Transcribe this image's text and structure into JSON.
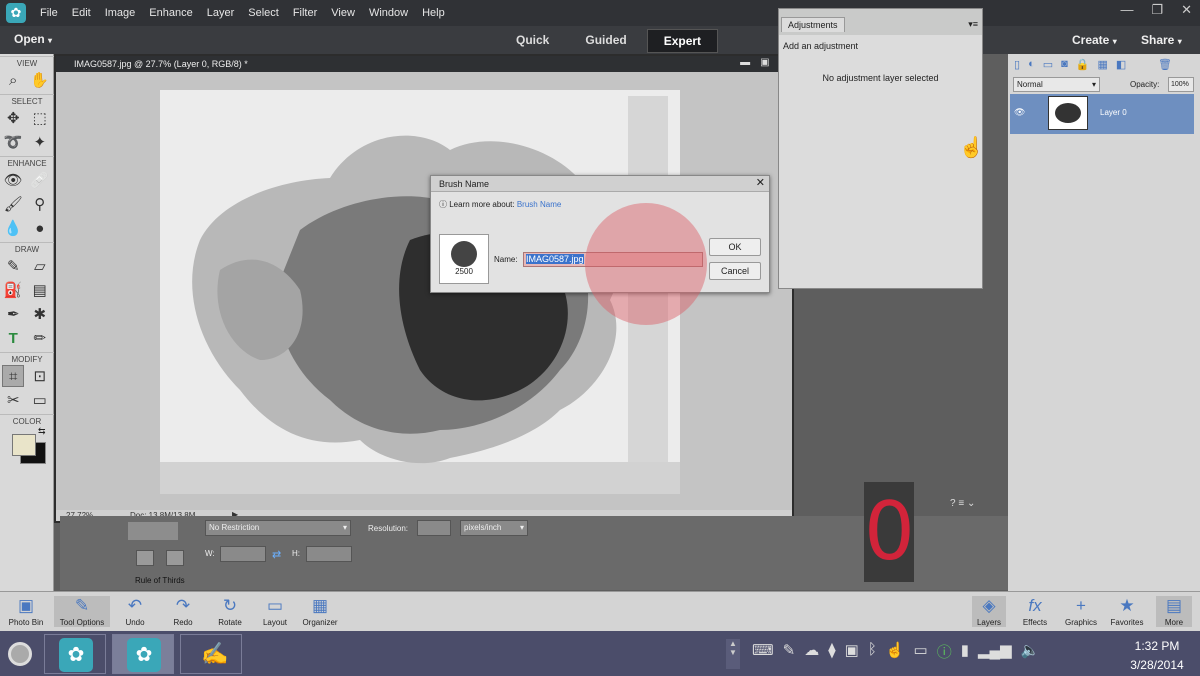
{
  "menubar": {
    "items": [
      "File",
      "Edit",
      "Image",
      "Enhance",
      "Layer",
      "Select",
      "Filter",
      "View",
      "Window",
      "Help"
    ],
    "window_controls": [
      "—",
      "❐",
      "✕"
    ]
  },
  "modebar": {
    "open": "Open",
    "tabs": [
      "Quick",
      "Guided",
      "Expert"
    ],
    "active_tab": "Expert",
    "create": "Create",
    "share": "Share"
  },
  "toolbox": {
    "sections": [
      "VIEW",
      "SELECT",
      "ENHANCE",
      "DRAW",
      "MODIFY",
      "COLOR"
    ]
  },
  "document": {
    "title": "IMAG0587.jpg @ 27.7% (Layer 0, RGB/8) *",
    "zoom": "27.72%",
    "doc_size": "Doc: 13.8M/13.8M"
  },
  "tool_options": {
    "aspect": "No Restriction",
    "w_label": "W:",
    "h_label": "H:",
    "resolution_label": "Resolution:",
    "resolution_unit": "pixels/inch",
    "overlay": "Rule of Thirds"
  },
  "adjustments": {
    "tab": "Adjustments",
    "add_label": "Add an adjustment",
    "empty_msg": "No adjustment layer selected"
  },
  "layers_panel": {
    "blend_mode": "Normal",
    "opacity_label": "Opacity:",
    "opacity_value": "100%",
    "layer_name": "Layer 0"
  },
  "dialog": {
    "title": "Brush Name",
    "learn_prefix": "Learn more about:",
    "learn_link": "Brush Name",
    "brush_size": "2500",
    "name_label": "Name:",
    "name_value": "IMAG0587.jpg",
    "ok": "OK",
    "cancel": "Cancel"
  },
  "counter": "0",
  "bottombar": {
    "left": [
      "Photo Bin",
      "Tool Options",
      "Undo",
      "Redo",
      "Rotate",
      "Layout",
      "Organizer"
    ],
    "right": [
      "Layers",
      "Effects",
      "Graphics",
      "Favorites",
      "More"
    ]
  },
  "taskbar": {
    "time": "1:32 PM",
    "date": "3/28/2014"
  }
}
